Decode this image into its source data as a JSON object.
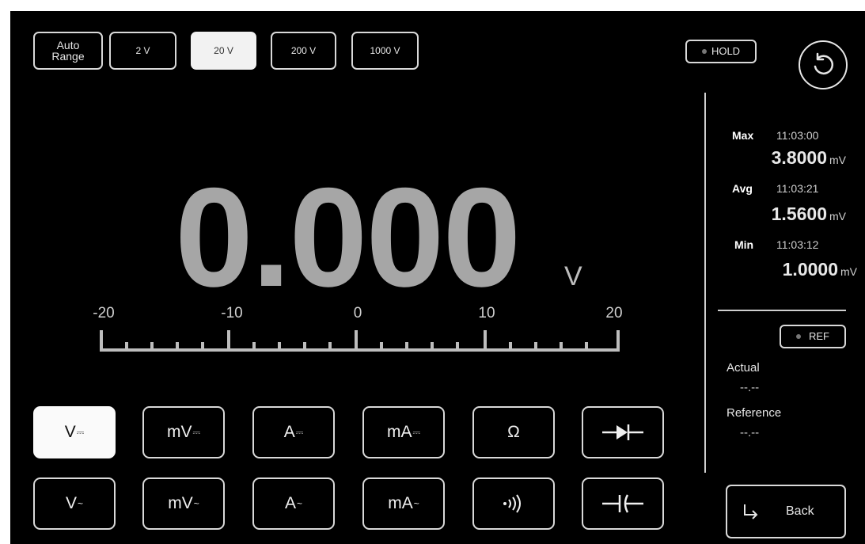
{
  "range_buttons": [
    {
      "label": "Auto\nRange",
      "active": false
    },
    {
      "label": "2 V",
      "active": false
    },
    {
      "label": "20 V",
      "active": true
    },
    {
      "label": "200 V",
      "active": false
    },
    {
      "label": "1000 V",
      "active": false
    }
  ],
  "hold": {
    "label": "HOLD"
  },
  "reading": {
    "value": "0.000",
    "unit": "V"
  },
  "scale": {
    "labels": [
      "-20",
      "-10",
      "0",
      "10",
      "20"
    ]
  },
  "stats": {
    "max": {
      "label": "Max",
      "time": "11:03:00",
      "value": "3.8000",
      "unit": "mV"
    },
    "avg": {
      "label": "Avg",
      "time": "11:03:21",
      "value": "1.5600",
      "unit": "mV"
    },
    "min": {
      "label": "Min",
      "time": "11:03:12",
      "value": "1.0000",
      "unit": "mV"
    }
  },
  "ref": {
    "label": "REF"
  },
  "actual": {
    "label": "Actual",
    "value": "--.--"
  },
  "reference": {
    "label": "Reference",
    "value": "--.--"
  },
  "back": {
    "label": "Back"
  },
  "modes_row1": [
    {
      "main": "V",
      "sub": "⎓",
      "active": true
    },
    {
      "main": "mV",
      "sub": "⎓",
      "active": false
    },
    {
      "main": "A",
      "sub": "⎓",
      "active": false
    },
    {
      "main": "mA",
      "sub": "⎓",
      "active": false
    },
    {
      "main": "Ω",
      "sub": "",
      "active": false
    },
    {
      "icon": "diode-icon",
      "active": false
    }
  ],
  "modes_row2": [
    {
      "main": "V",
      "sub": "~",
      "active": false
    },
    {
      "main": "mV",
      "sub": "~",
      "active": false
    },
    {
      "main": "A",
      "sub": "~",
      "active": false
    },
    {
      "main": "mA",
      "sub": "~",
      "active": false
    },
    {
      "icon": "continuity-icon",
      "active": false
    },
    {
      "icon": "capacitor-icon",
      "active": false
    }
  ]
}
